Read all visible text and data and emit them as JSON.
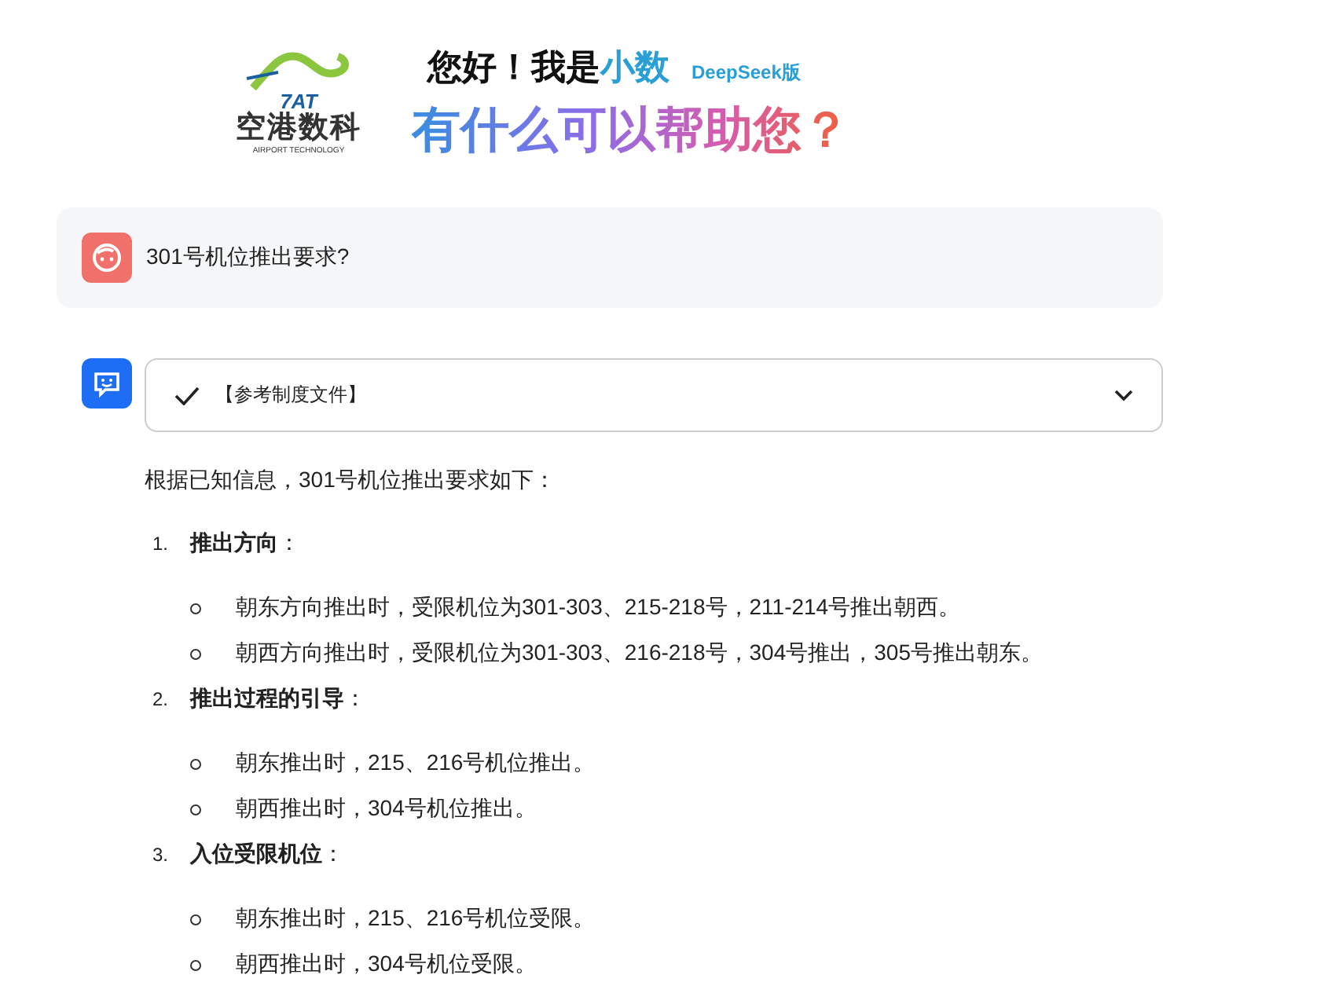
{
  "header": {
    "logo_mark": "7AT",
    "logo_name": "空港数科",
    "logo_tagline": "AIRPORT TECHNOLOGY",
    "greeting": "您好！我是",
    "assistant_name": "小数",
    "edition": "DeepSeek版",
    "headline": "有什么可以帮助您？"
  },
  "user_message": {
    "text": "301号机位推出要求?"
  },
  "reply": {
    "reference": {
      "label": "【参考制度文件】",
      "checked": true,
      "expanded": false
    },
    "intro": "根据已知信息，301号机位推出要求如下：",
    "sections": [
      {
        "number": "1.",
        "title": "**推出方向**：",
        "items": [
          "朝东方向推出时，受限机位为301-303、215-218号，211-214号推出朝西。",
          "朝西方向推出时，受限机位为301-303、216-218号，304号推出，305号推出朝东。"
        ]
      },
      {
        "number": "2.",
        "title": "**推出过程的引导**：",
        "items": [
          "朝东推出时，215、216号机位推出。",
          "朝西推出时，304号机位推出。"
        ]
      },
      {
        "number": "3.",
        "title": "**入位受限机位**：",
        "items": [
          "朝东推出时，215、216号机位受限。",
          "朝西推出时，304号机位受限。"
        ]
      }
    ]
  }
}
